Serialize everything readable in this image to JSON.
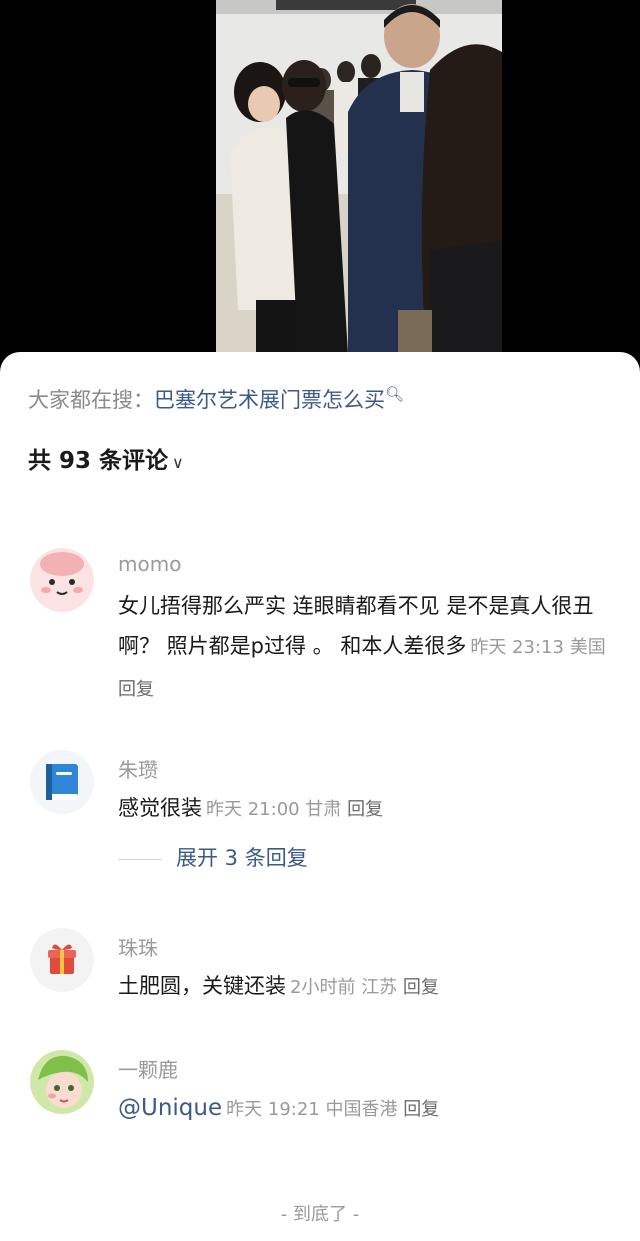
{
  "hot_search": {
    "prefix": "大家都在搜：",
    "query": "巴塞尔艺术展门票怎么买",
    "icon": "search-icon"
  },
  "comments_header": {
    "label": "共 93 条评论",
    "icon": "chevron-down-icon"
  },
  "comments": [
    {
      "user": "momo",
      "text": "女儿捂得那么严实 连眼睛都看不见 是不是真人很丑啊？ 照片都是p过得 。 和本人差很多",
      "time": "昨天 23:13",
      "location": "美国",
      "reply_label": "回复"
    },
    {
      "user": "朱瓒",
      "text": "感觉很装",
      "time": "昨天 21:00",
      "location": "甘肃",
      "reply_label": "回复",
      "expand_label": "展开 3 条回复"
    },
    {
      "user": "珠珠",
      "text": "土肥圆，关键还装",
      "time": "2小时前",
      "location": "江苏",
      "reply_label": "回复"
    },
    {
      "user": "一颗鹿",
      "text": "@Unique",
      "time": "昨天 19:21",
      "location": "中国香港",
      "reply_label": "回复"
    }
  ],
  "end_label": "- 到底了 -",
  "colors": {
    "link": "#3b5a8a",
    "muted": "#9a9a9a",
    "text": "#1a1a1a"
  }
}
